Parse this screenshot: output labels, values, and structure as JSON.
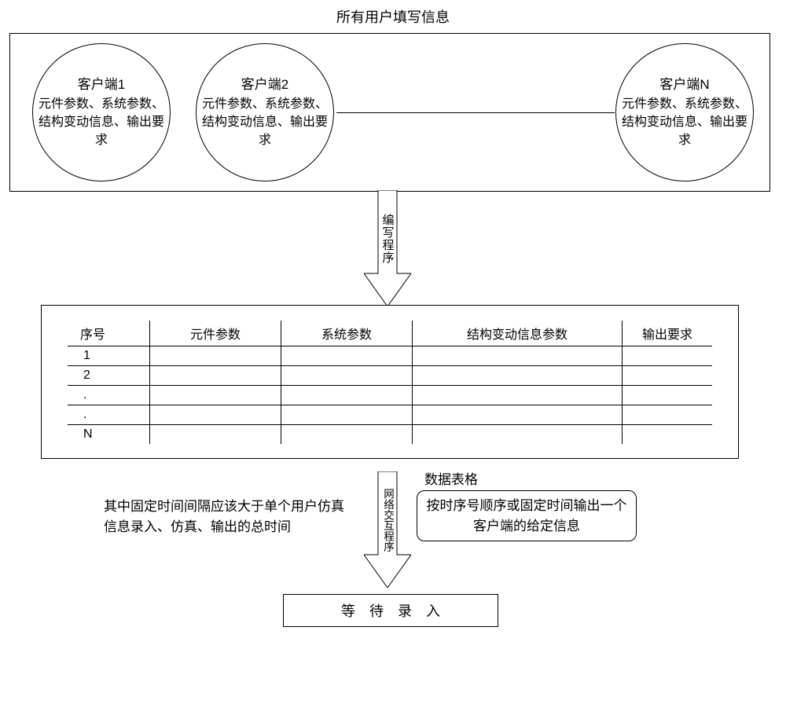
{
  "title": "所有用户填写信息",
  "clients": {
    "c1": {
      "title": "客户端1",
      "body": "元件参数、系统参数、结构变动信息、输出要求"
    },
    "c2": {
      "title": "客户端2",
      "body": "元件参数、系统参数、结构变动信息、输出要求"
    },
    "cn": {
      "title": "客户端N",
      "body": "元件参数、系统参数、结构变动信息、输出要求"
    }
  },
  "arrows": {
    "a1": "编写程序",
    "a2": "网络交互程序"
  },
  "table": {
    "caption": "数据表格",
    "headers": {
      "seq": "序号",
      "component": "元件参数",
      "system": "系统参数",
      "struct": "结构变动信息参数",
      "output": "输出要求"
    },
    "rows": [
      "1",
      "2",
      ".",
      ".",
      "N"
    ]
  },
  "notes": {
    "left": "其中固定时间间隔应该大于单个用户仿真信息录入、仿真、输出的总时间",
    "right": "按时序号顺序或固定时间输出一个客户端的给定信息"
  },
  "wait": "等待录入"
}
